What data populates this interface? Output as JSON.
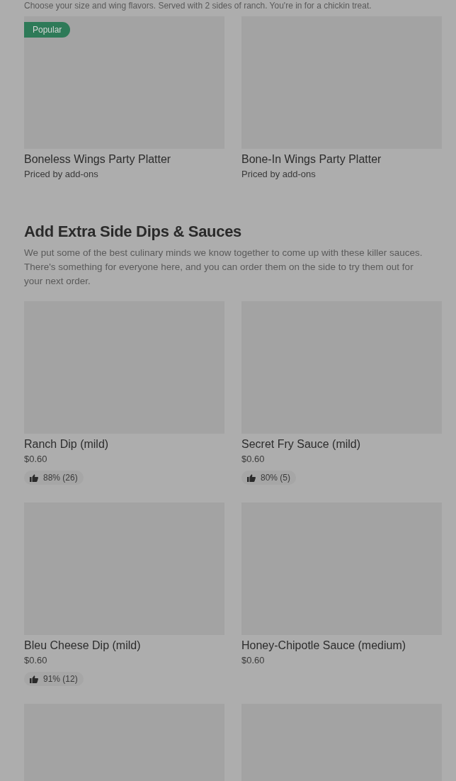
{
  "intro": "Choose your size and wing flavors. Served with 2 sides of ranch. You're in for a chickin treat.",
  "platters": [
    {
      "name": "Boneless Wings Party Platter",
      "subtitle": "Priced by add-ons",
      "badge": "Popular"
    },
    {
      "name": "Bone-In Wings Party Platter",
      "subtitle": "Priced by add-ons"
    }
  ],
  "section": {
    "title": "Add Extra Side Dips & Sauces",
    "description": "We put some of the best culinary minds we know together to come up with these killer sauces. There's something for everyone here, and you can order them on the side to try them out for your next order.",
    "items": [
      {
        "kind": "product",
        "name": "Ranch Dip (mild)",
        "price": "$0.60",
        "rating": "88% (26)"
      },
      {
        "kind": "product",
        "name": "Secret Fry Sauce (mild)",
        "price": "$0.60",
        "rating": "80% (5)"
      },
      {
        "kind": "product",
        "name": "Bleu Cheese Dip (mild)",
        "price": "$0.60",
        "rating": "91% (12)"
      },
      {
        "kind": "product",
        "name": "Honey-Chipotle Sauce (medium)",
        "price": "$0.60"
      },
      {
        "kind": "picture"
      },
      {
        "kind": "picture"
      }
    ]
  }
}
